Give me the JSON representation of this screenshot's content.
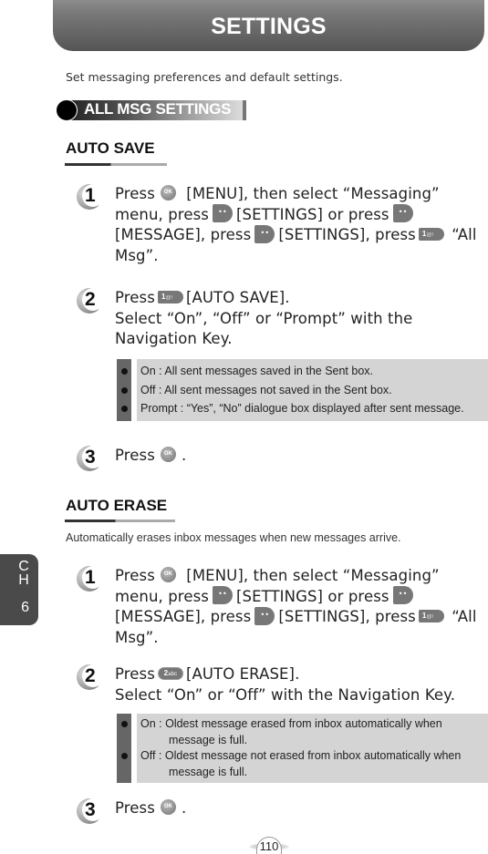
{
  "header": {
    "title": "SETTINGS"
  },
  "intro": "Set messaging preferences and default settings.",
  "section": {
    "title": "ALL MSG SETTINGS"
  },
  "keys": {
    "ok": "OK",
    "soft": "••",
    "num1": "1",
    "num1_sub": "@/",
    "num2": "2",
    "num2_sub": "abc"
  },
  "auto_save": {
    "heading": "AUTO SAVE",
    "steps": [
      {
        "num": "1",
        "parts": {
          "a": "Press",
          "b": "[MENU], then select “Messaging” menu, press",
          "c": "[SETTINGS] or press",
          "d": "[MESSAGE], press",
          "e": "[SETTINGS], press",
          "f": "“All Msg”."
        }
      },
      {
        "num": "2",
        "parts": {
          "a": "Press",
          "b": "[AUTO SAVE].",
          "c": "Select “On”, “Off” or “Prompt” with the Navigation Key."
        }
      },
      {
        "num": "3",
        "parts": {
          "a": "Press",
          "b": "."
        }
      }
    ],
    "options": [
      "On : All sent messages saved in the Sent box.",
      "Off : All sent messages not saved in the Sent box.",
      "Prompt : “Yes”, “No” dialogue box displayed after sent message."
    ]
  },
  "auto_erase": {
    "heading": "AUTO ERASE",
    "description": "Automatically erases inbox messages when new messages arrive.",
    "steps": [
      {
        "num": "1",
        "parts": {
          "a": "Press",
          "b": "[MENU], then select “Messaging” menu, press",
          "c": "[SETTINGS] or press",
          "d": "[MESSAGE], press",
          "e": "[SETTINGS], press",
          "f": "“All Msg”."
        }
      },
      {
        "num": "2",
        "parts": {
          "a": "Press",
          "b": "[AUTO ERASE].",
          "c": "Select “On” or “Off” with the Navigation Key."
        }
      },
      {
        "num": "3",
        "parts": {
          "a": "Press",
          "b": "."
        }
      }
    ],
    "options": [
      {
        "line1": "On : Oldest message erased from inbox automatically when",
        "line2": "message is full."
      },
      {
        "line1": "Off : Oldest message not erased from inbox automatically when",
        "line2": "message is full."
      }
    ]
  },
  "chapter_tab": {
    "letters": [
      "C",
      "H"
    ],
    "number": "6"
  },
  "page_number": "110"
}
